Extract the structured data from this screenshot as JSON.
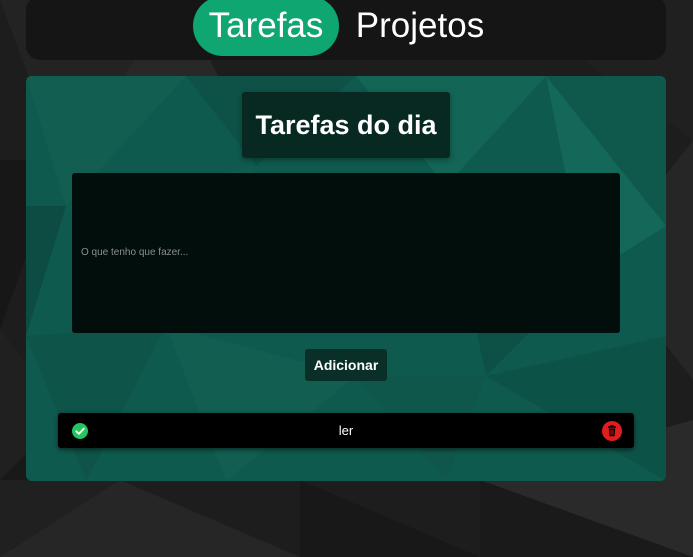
{
  "nav": {
    "tabs": [
      {
        "label": "Tarefas",
        "active": true
      },
      {
        "label": "Projetos",
        "active": false
      }
    ]
  },
  "card": {
    "title": "Tarefas do dia",
    "input": {
      "value": "",
      "placeholder": "O que tenho que fazer..."
    },
    "add_label": "Adicionar",
    "tasks": [
      {
        "text": "ler",
        "done_icon": "check-circle-icon",
        "delete_icon": "trash-icon"
      }
    ]
  },
  "colors": {
    "accent": "#0fa672",
    "card": "#0f5a4e",
    "complete": "#22c55e",
    "delete": "#e11d1d"
  }
}
